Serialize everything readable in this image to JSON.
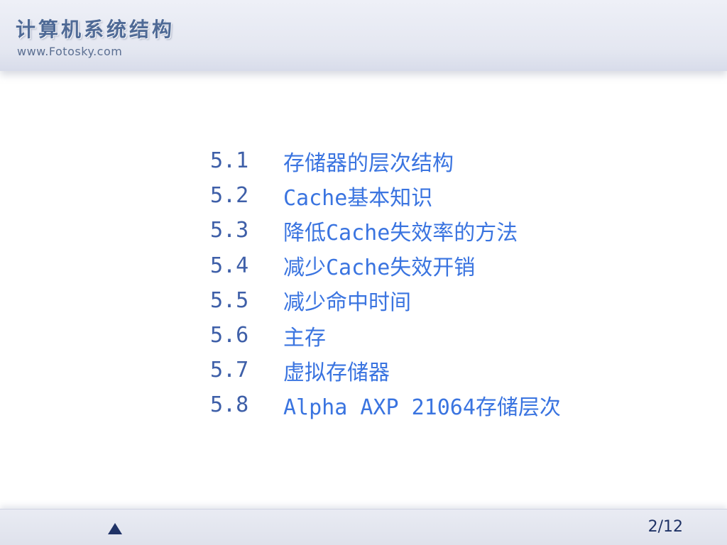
{
  "header": {
    "title": "计算机系统结构",
    "url": "www.Fotosky.com"
  },
  "toc": {
    "items": [
      {
        "number": "5.1",
        "label": "存储器的层次结构"
      },
      {
        "number": "5.2",
        "label": "Cache基本知识"
      },
      {
        "number": "5.3",
        "label": "降低Cache失效率的方法"
      },
      {
        "number": "5.4",
        "label": "减少Cache失效开销"
      },
      {
        "number": "5.5",
        "label": "减少命中时间"
      },
      {
        "number": "5.6",
        "label": "主存"
      },
      {
        "number": "5.7",
        "label": "虚拟存储器"
      },
      {
        "number": "5.8",
        "label": "Alpha AXP 21064存储层次"
      }
    ]
  },
  "footer": {
    "nav_icon": "triangle-up-icon",
    "page_indicator": "2/12"
  },
  "colors": {
    "title": "#4f6a96",
    "toc_text": "#3a74e0",
    "nav": "#1f3266"
  }
}
